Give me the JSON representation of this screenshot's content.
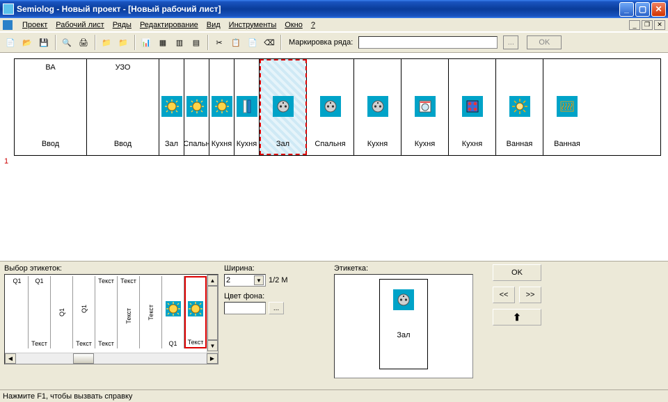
{
  "window": {
    "title": "Semiolog - Новый проект - [Новый рабочий лист]"
  },
  "menu": {
    "items": [
      "Проект",
      "Рабочий лист",
      "Ряды",
      "Редактирование",
      "Вид",
      "Инструменты",
      "Окно",
      "?"
    ]
  },
  "toolbar": {
    "marking_label": "Маркировка ряда:",
    "marking_value": "",
    "dots": "...",
    "ok": "OK"
  },
  "row_number": "1",
  "strip": [
    {
      "top": "ВА",
      "bot": "Ввод",
      "icon": "",
      "w": 104
    },
    {
      "top": "УЗО",
      "bot": "Ввод",
      "icon": "",
      "w": 104
    },
    {
      "top": "",
      "bot": "Зал",
      "icon": "lamp",
      "w": 36
    },
    {
      "top": "",
      "bot": "Спальн",
      "icon": "lamp",
      "w": 36
    },
    {
      "top": "",
      "bot": "Кухня",
      "icon": "lamp",
      "w": 36
    },
    {
      "top": "",
      "bot": "Кухня",
      "icon": "bar",
      "w": 36
    },
    {
      "top": "",
      "bot": "Зал",
      "icon": "socket",
      "w": 68,
      "selected": true
    },
    {
      "top": "",
      "bot": "Спальня",
      "icon": "socket",
      "w": 68
    },
    {
      "top": "",
      "bot": "Кухня",
      "icon": "socket",
      "w": 68
    },
    {
      "top": "",
      "bot": "Кухня",
      "icon": "washer",
      "w": 68
    },
    {
      "top": "",
      "bot": "Кухня",
      "icon": "stove",
      "w": 68
    },
    {
      "top": "",
      "bot": "Ванная",
      "icon": "sun",
      "w": 68
    },
    {
      "top": "",
      "bot": "Ванная",
      "icon": "heater",
      "w": 68
    }
  ],
  "bottom": {
    "selector_label": "Выбор этикеток:",
    "width_label": "Ширина:",
    "width_value": "2",
    "width_unit": "1/2 M",
    "bg_label": "Цвет фона:",
    "bg_dots": "...",
    "preview_label": "Этикетка:",
    "preview_text": "Зал",
    "ok": "OK",
    "prev": "<<",
    "next": ">>",
    "up": "⬆",
    "picker": [
      {
        "top": "Q1",
        "bot": "",
        "icon": ""
      },
      {
        "top": "Q1",
        "bot": "Текст",
        "icon": ""
      },
      {
        "top": "",
        "bot": "",
        "icon": "",
        "rot": "Q1"
      },
      {
        "top": "",
        "bot": "Текст",
        "icon": "",
        "rot": "Q1"
      },
      {
        "top": "Текст",
        "bot": "Текст",
        "icon": "",
        "rot": ""
      },
      {
        "top": "Текст",
        "bot": "",
        "icon": "",
        "rot": "Текст"
      },
      {
        "top": "",
        "bot": "",
        "icon": "",
        "rot": "Текст"
      },
      {
        "top": "",
        "bot": "Q1",
        "icon": "lamp"
      },
      {
        "top": "",
        "bot": "Текст",
        "icon": "lamp",
        "sel": true
      }
    ]
  },
  "status": "Нажмите F1, чтобы вызвать справку"
}
